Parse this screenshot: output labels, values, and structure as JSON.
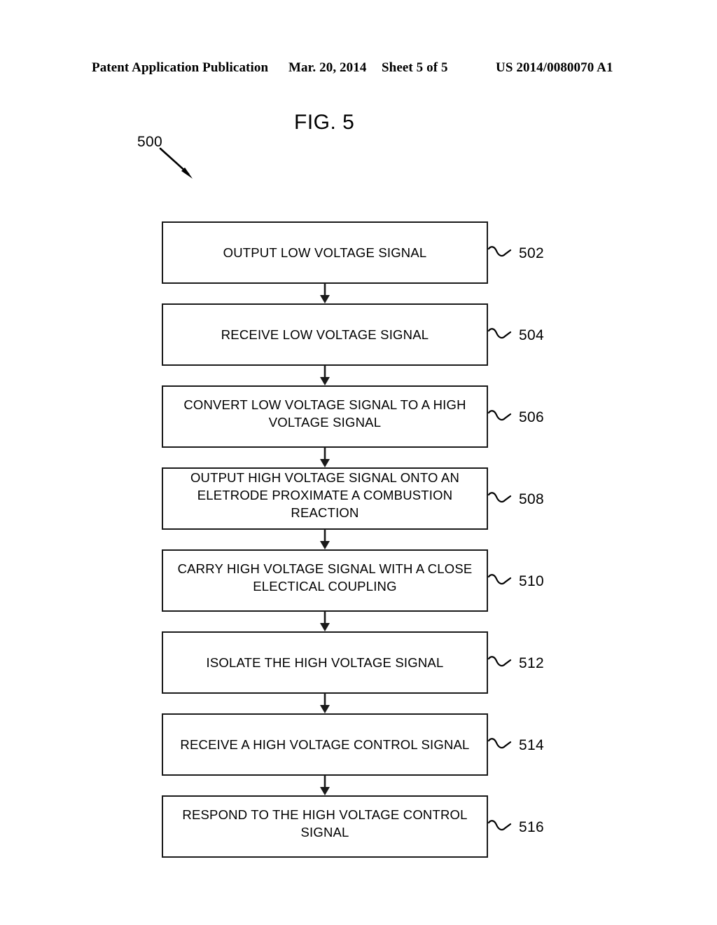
{
  "header": {
    "publication": "Patent Application Publication",
    "date": "Mar. 20, 2014",
    "sheet": "Sheet 5 of 5",
    "document_number": "US 2014/0080070 A1"
  },
  "figure": {
    "title": "FIG. 5",
    "reference_numeral": "500"
  },
  "flowchart": {
    "steps": [
      {
        "label": "OUTPUT LOW VOLTAGE SIGNAL",
        "ref": "502",
        "lines": 1
      },
      {
        "label": "RECEIVE LOW VOLTAGE SIGNAL",
        "ref": "504",
        "lines": 1
      },
      {
        "label": "CONVERT LOW VOLTAGE SIGNAL TO A HIGH VOLTAGE SIGNAL",
        "ref": "506",
        "lines": 2
      },
      {
        "label": "OUTPUT HIGH VOLTAGE SIGNAL ONTO AN ELETRODE PROXIMATE A COMBUSTION REACTION",
        "ref": "508",
        "lines": 3
      },
      {
        "label": "CARRY HIGH VOLTAGE SIGNAL WITH A CLOSE ELECTICAL COUPLING",
        "ref": "510",
        "lines": 2
      },
      {
        "label": "ISOLATE THE HIGH VOLTAGE SIGNAL",
        "ref": "512",
        "lines": 1
      },
      {
        "label": "RECEIVE A HIGH VOLTAGE CONTROL SIGNAL",
        "ref": "514",
        "lines": 1
      },
      {
        "label": "RESPOND TO THE HIGH VOLTAGE CONTROL SIGNAL",
        "ref": "516",
        "lines": 2
      }
    ]
  },
  "colors": {
    "ink": "#000000",
    "line": "#1a1a1a",
    "page": "#ffffff"
  }
}
